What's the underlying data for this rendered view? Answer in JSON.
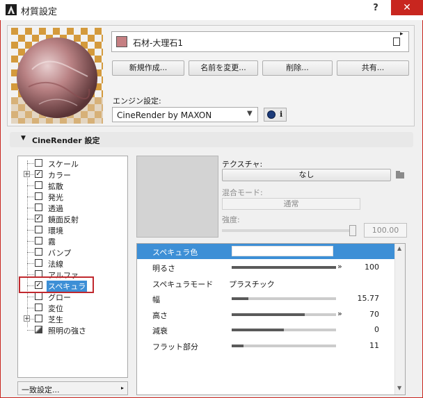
{
  "window": {
    "title": "材質設定",
    "help_label": "?",
    "close_label": "✕"
  },
  "material": {
    "name": "石材-大理石1",
    "swatch_color": "#c57f82"
  },
  "buttons": {
    "new": "新規作成...",
    "rename": "名前を変更...",
    "delete": "削除...",
    "share": "共有..."
  },
  "engine": {
    "label": "エンジン設定:",
    "value": "CineRender by MAXON",
    "info_label": "i"
  },
  "section": {
    "title": "CineRender 設定"
  },
  "channels": [
    {
      "label": "スケール",
      "checked": null
    },
    {
      "label": "カラー",
      "checked": true,
      "expandable": true
    },
    {
      "label": "拡散",
      "checked": false
    },
    {
      "label": "発光",
      "checked": false
    },
    {
      "label": "透過",
      "checked": false
    },
    {
      "label": "鏡面反射",
      "checked": true
    },
    {
      "label": "環境",
      "checked": false
    },
    {
      "label": "霧",
      "checked": false
    },
    {
      "label": "バンプ",
      "checked": false
    },
    {
      "label": "法線",
      "checked": false
    },
    {
      "label": "アルファ",
      "checked": false
    },
    {
      "label": "スペキュラ",
      "checked": true,
      "selected": true
    },
    {
      "label": "グロー",
      "checked": false
    },
    {
      "label": "変位",
      "checked": false
    },
    {
      "label": "芝生",
      "checked": false,
      "expandable": true
    },
    {
      "label": "照明の強さ",
      "checked": null
    }
  ],
  "bottom": {
    "consistency_label": "一致設定..."
  },
  "texture": {
    "label": "テクスチャ:",
    "value": "なし",
    "blend_label": "混合モード:",
    "blend_value": "通常",
    "strength_label": "強度:",
    "strength_value": "100.00",
    "strength_level": 1.0
  },
  "specular": {
    "color_label": "スペキュラ色",
    "rows": [
      {
        "label": "明るさ",
        "value": "100",
        "level": 1.0,
        "arrow": true
      },
      {
        "label": "スペキュラモード",
        "value": "プラスチック"
      },
      {
        "label": "幅",
        "value": "15.77",
        "level": 0.16,
        "arrow": false
      },
      {
        "label": "高さ",
        "value": "70",
        "level": 0.7,
        "arrow": true
      },
      {
        "label": "減衰",
        "value": "0",
        "level": 0.5,
        "arrow": false
      },
      {
        "label": "フラット部分",
        "value": "11",
        "level": 0.11,
        "arrow": false
      }
    ]
  }
}
